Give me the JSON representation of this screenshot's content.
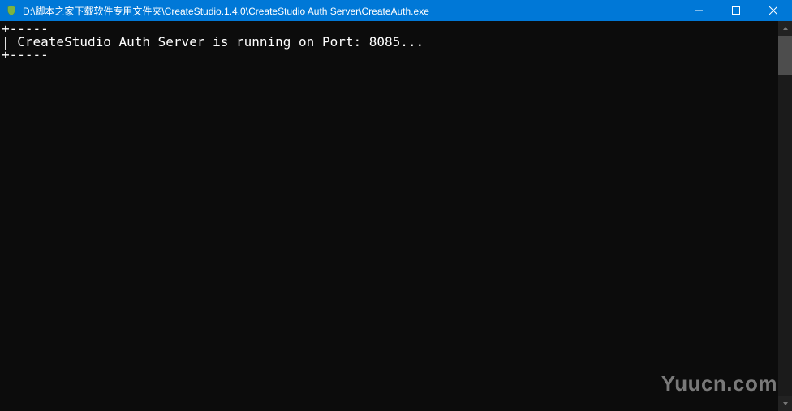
{
  "window": {
    "title": "D:\\脚本之家下载软件专用文件夹\\CreateStudio.1.4.0\\CreateStudio Auth Server\\CreateAuth.exe",
    "icon_name": "shield-icon"
  },
  "console": {
    "lines": [
      "+-----",
      "| CreateStudio Auth Server is running on Port: 8085...",
      "+-----"
    ]
  },
  "watermark": {
    "text": "Yuucn.com"
  },
  "controls": {
    "minimize": "Minimize",
    "maximize": "Maximize",
    "close": "Close"
  }
}
